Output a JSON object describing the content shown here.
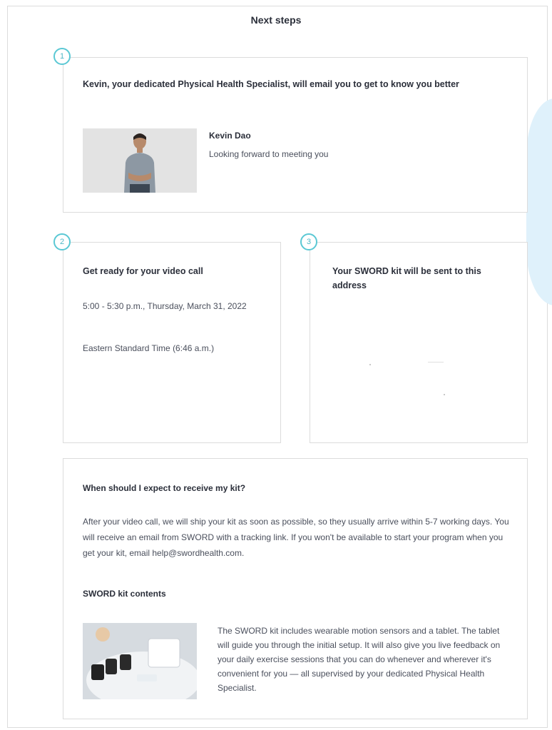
{
  "page": {
    "title": "Next steps"
  },
  "steps": [
    {
      "number": "1",
      "heading": "Kevin, your dedicated Physical Health Specialist, will email you to get to know you better",
      "specialist_name": "Kevin Dao",
      "specialist_message": "Looking forward to meeting you"
    },
    {
      "number": "2",
      "heading": "Get ready for your video call",
      "datetime": "5:00 - 5:30 p.m., Thursday, March 31, 2022",
      "timezone": "Eastern Standard Time (6:46 a.m.)"
    },
    {
      "number": "3",
      "heading": "Your SWORD kit will be sent to this address"
    }
  ],
  "faq": {
    "question": "When should I expect to receive my kit?",
    "answer": "After your video call, we will ship your kit as soon as possible, so they usually arrive within 5-7 working days. You will receive an email from SWORD with a tracking link. If you won't be available to start your program when you get your kit, email help@swordhealth.com.",
    "contents_heading": "SWORD kit contents",
    "contents_text": "The SWORD kit includes wearable motion sensors and a tablet. The tablet will guide you through the initial setup. It will also give you live feedback on your daily exercise sessions that you can do whenever and wherever it's convenient for you — all supervised by your dedicated Physical Health Specialist."
  },
  "colors": {
    "accent": "#5ac8d4",
    "blob": "#dff1fb",
    "border": "#dcdcdc",
    "text": "#2b2f3a"
  }
}
